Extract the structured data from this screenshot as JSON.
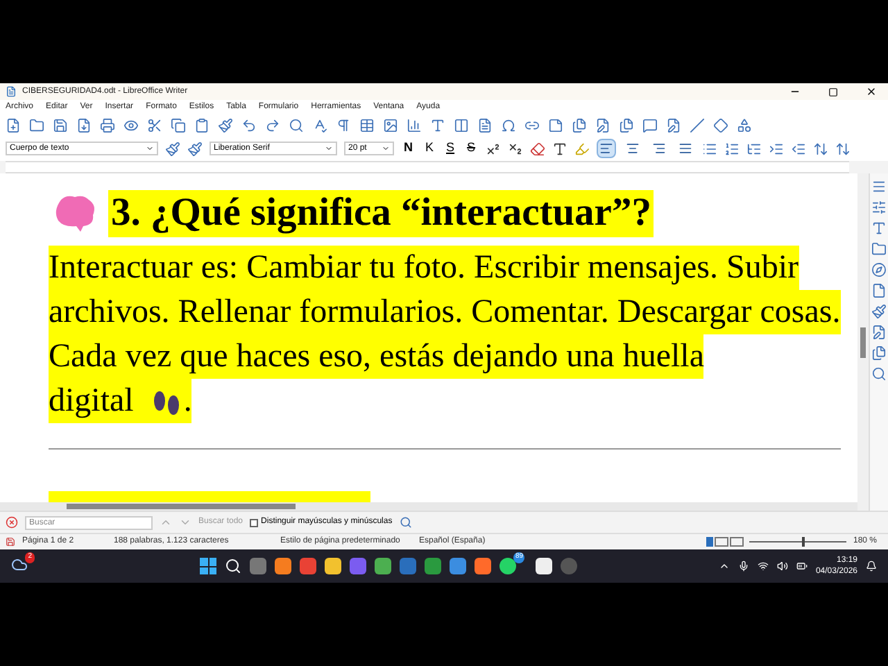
{
  "window": {
    "title": "CIBERSEGURIDAD4.odt - LibreOffice Writer"
  },
  "menu": [
    "Archivo",
    "Editar",
    "Ver",
    "Insertar",
    "Formato",
    "Estilos",
    "Tabla",
    "Formulario",
    "Herramientas",
    "Ventana",
    "Ayuda"
  ],
  "format_bar": {
    "paragraph_style": "Cuerpo de texto",
    "font": "Liberation Serif",
    "size": "20 pt",
    "bold": "N",
    "italic": "K",
    "underline": "S",
    "strike": "S",
    "alignment": [
      {
        "selected": true
      },
      {
        "selected": false
      },
      {
        "selected": false
      },
      {
        "selected": false
      }
    ]
  },
  "document": {
    "heading": "3. ¿Qué significa “interactuar”?",
    "paragraph_lines": [
      "Interactuar es: Cambiar tu foto. Escribir mensajes. Subir",
      "archivos. Rellenar formularios. Comentar. Descargar cosas.",
      "Cada vez que haces eso, estás dejando una huella",
      "digital"
    ],
    "paragraph_end": "."
  },
  "find_bar": {
    "placeholder": "Buscar",
    "find_all": "Buscar todo",
    "match_case": {
      "label": "Distinguir mayúsculas y minúsculas",
      "checked": false
    }
  },
  "status_bar": {
    "page": "Página 1 de 2",
    "words": "188 palabras, 1.123 caracteres",
    "page_style": "Estilo de página predeterminado",
    "language": "Español (España)",
    "zoom": "180 %",
    "zoom_level": {
      "level": 0.55
    }
  },
  "taskbar": {
    "weather_badge": "2",
    "chat_badge": "89",
    "time": "13:19",
    "date": "04/03/2026"
  }
}
